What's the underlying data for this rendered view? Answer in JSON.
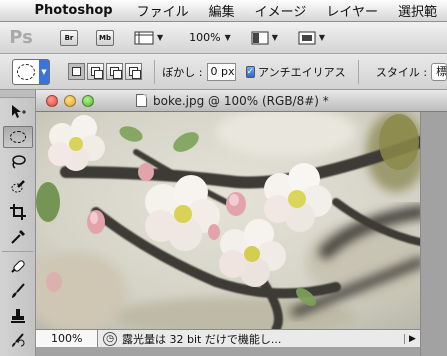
{
  "menubar": {
    "apple": "",
    "app_name": "Photoshop",
    "items": [
      "ファイル",
      "編集",
      "イメージ",
      "レイヤー",
      "選択範"
    ]
  },
  "appbar": {
    "logo": "Ps",
    "bridge_label": "Br",
    "minibridge_label": "Mb",
    "zoom_value": "100%"
  },
  "options": {
    "feather_label": "ぼかし :",
    "feather_value": "0 px",
    "antialias_label": "アンチエイリアス",
    "antialias_checked": true,
    "style_label": "スタイル :",
    "style_value": "標準"
  },
  "document": {
    "title": "boke.jpg @ 100% (RGB/8#) *",
    "zoom": "100%",
    "status_message": "露光量は 32 bit だけで機能し..."
  },
  "tools": [
    "move-tool",
    "elliptical-marquee-tool",
    "lasso-tool",
    "quick-selection-tool",
    "crop-tool",
    "eyedropper-tool",
    "spot-healing-brush-tool",
    "brush-tool",
    "clone-stamp-tool",
    "history-brush-tool"
  ],
  "colors": {
    "accent_blue": "#3a73d9",
    "close": "#e0443a",
    "minimize": "#e0a51e",
    "zoom": "#4fb52d"
  }
}
